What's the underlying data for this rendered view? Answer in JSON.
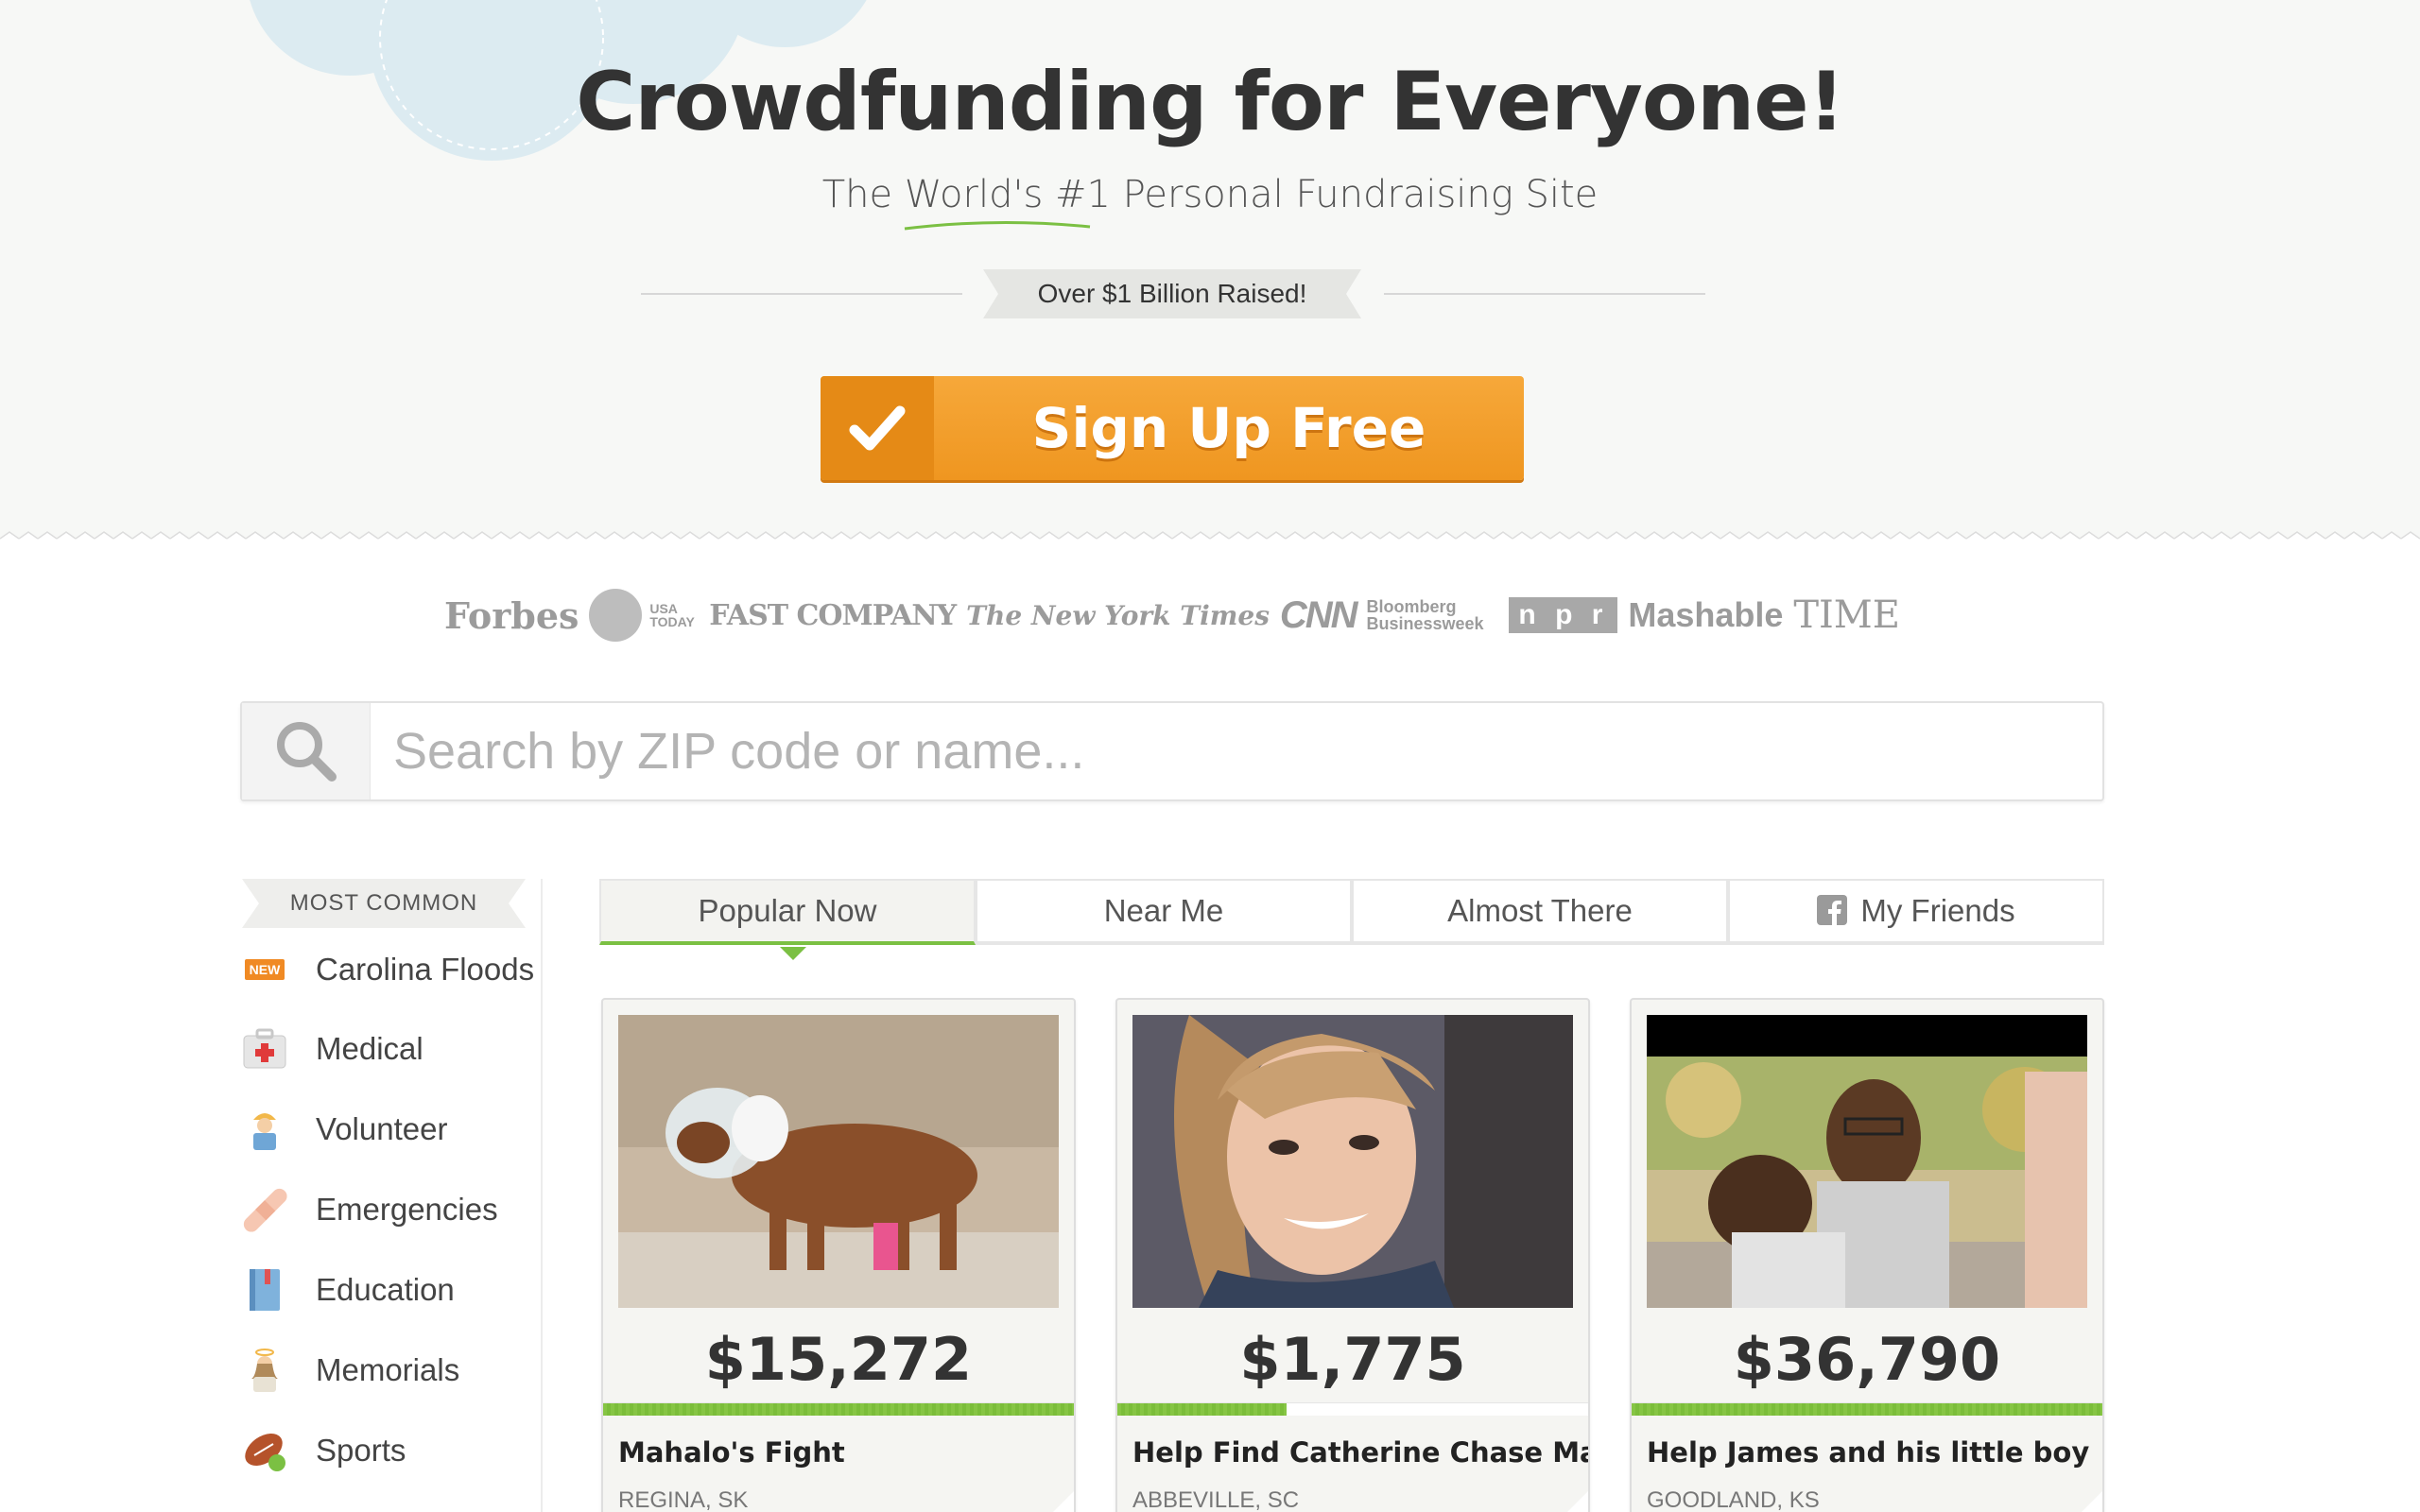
{
  "hero": {
    "title": "Crowdfunding for Everyone!",
    "subtitle": "The World's #1 Personal Fundraising Site",
    "raised_badge": "Over $1 Billion Raised!",
    "signup_label": "Sign Up Free"
  },
  "press_logos": [
    {
      "name": "Forbes",
      "text": "Forbes"
    },
    {
      "name": "USA TODAY",
      "text": "USA TODAY"
    },
    {
      "name": "FAST COMPANY",
      "text": "FAST COMPANY"
    },
    {
      "name": "The New York Times",
      "text": "The New York Times"
    },
    {
      "name": "CNN",
      "text": "CNN"
    },
    {
      "name": "Bloomberg Businessweek",
      "text": "Bloomberg Businessweek"
    },
    {
      "name": "npr",
      "text": "n p r"
    },
    {
      "name": "Mashable",
      "text": "Mashable"
    },
    {
      "name": "TIME",
      "text": "TIME"
    }
  ],
  "search": {
    "placeholder": "Search by ZIP code or name..."
  },
  "sidebar": {
    "heading": "MOST COMMON",
    "categories": [
      {
        "label": "Carolina Floods",
        "icon": "new-badge-icon",
        "badge": "NEW"
      },
      {
        "label": "Medical",
        "icon": "first-aid-kit-icon"
      },
      {
        "label": "Volunteer",
        "icon": "volunteer-worker-icon"
      },
      {
        "label": "Emergencies",
        "icon": "bandage-icon"
      },
      {
        "label": "Education",
        "icon": "book-icon"
      },
      {
        "label": "Memorials",
        "icon": "angel-icon"
      },
      {
        "label": "Sports",
        "icon": "football-icon"
      }
    ]
  },
  "tabs": [
    {
      "label": "Popular Now",
      "active": true
    },
    {
      "label": "Near Me",
      "active": false
    },
    {
      "label": "Almost There",
      "active": false
    },
    {
      "label": "My Friends",
      "active": false,
      "icon": "facebook-icon"
    }
  ],
  "campaigns": [
    {
      "amount": "$15,272",
      "title": "Mahalo's Fight",
      "location": "REGINA, SK",
      "progress": 1.0,
      "image": "injured dog with cone photo"
    },
    {
      "amount": "$1,775",
      "title": "Help Find Catherine Chase Martin!",
      "location": "ABBEVILLE, SC",
      "progress": 0.36,
      "image": "smiling young woman selfie photo"
    },
    {
      "amount": "$36,790",
      "title": "Help James and his little boy",
      "location": "GOODLAND, KS",
      "progress": 1.0,
      "image": "man holding child on street photo"
    }
  ],
  "colors": {
    "accent_orange": "#f19d2a",
    "progress_green": "#7bc043",
    "hero_bg": "#f7f8f6"
  }
}
